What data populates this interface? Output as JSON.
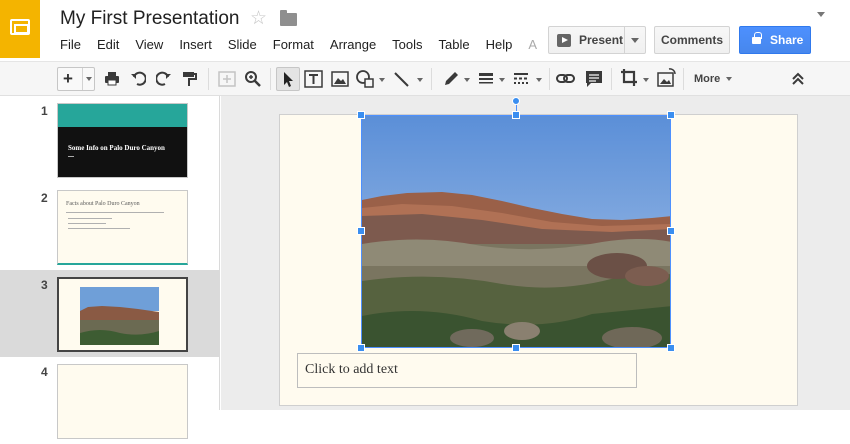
{
  "window": {
    "title": "My First Presentation"
  },
  "header": {
    "menu": [
      "File",
      "Edit",
      "View",
      "Insert",
      "Slide",
      "Format",
      "Arrange",
      "Tools",
      "Table",
      "Help",
      "A"
    ],
    "present_label": "Present",
    "comments_label": "Comments",
    "share_label": "Share",
    "share_color": "#4d90fe",
    "logo_color": "#f4b400"
  },
  "toolbar": {
    "tools": [
      "new-slide",
      "print",
      "undo",
      "redo",
      "paint-format",
      "zoom-fit",
      "zoom",
      "select",
      "text-box",
      "image",
      "shape",
      "line",
      "border-color",
      "border-weight",
      "border-dash",
      "link",
      "comment",
      "crop",
      "replace-image"
    ],
    "more_label": "More"
  },
  "filmstrip": {
    "slides": [
      {
        "number": "1",
        "title": "Some Info on Palo Duro Canyon",
        "style": "title-dark",
        "accent": "#26a69a"
      },
      {
        "number": "2",
        "title": "Facts about Palo Duro Canyon",
        "style": "bullets"
      },
      {
        "number": "3",
        "title": "",
        "style": "image",
        "selected": true
      },
      {
        "number": "4",
        "title": "",
        "style": "blank"
      }
    ]
  },
  "canvas": {
    "placeholder_text": "Click to add text"
  }
}
